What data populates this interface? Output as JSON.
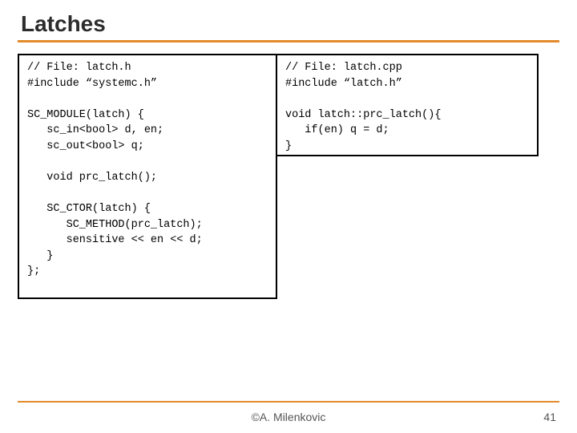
{
  "title": "Latches",
  "code_left": "// File: latch.h\n#include “systemc.h”\n\nSC_MODULE(latch) {\n   sc_in<bool> d, en;\n   sc_out<bool> q;\n\n   void prc_latch();\n\n   SC_CTOR(latch) {\n      SC_METHOD(prc_latch);\n      sensitive << en << d;\n   }\n};",
  "code_right": "// File: latch.cpp\n#include “latch.h”\n\nvoid latch::prc_latch(){\n   if(en) q = d;\n}",
  "footer": {
    "author": "©A. Milenkovic",
    "page": "41"
  }
}
